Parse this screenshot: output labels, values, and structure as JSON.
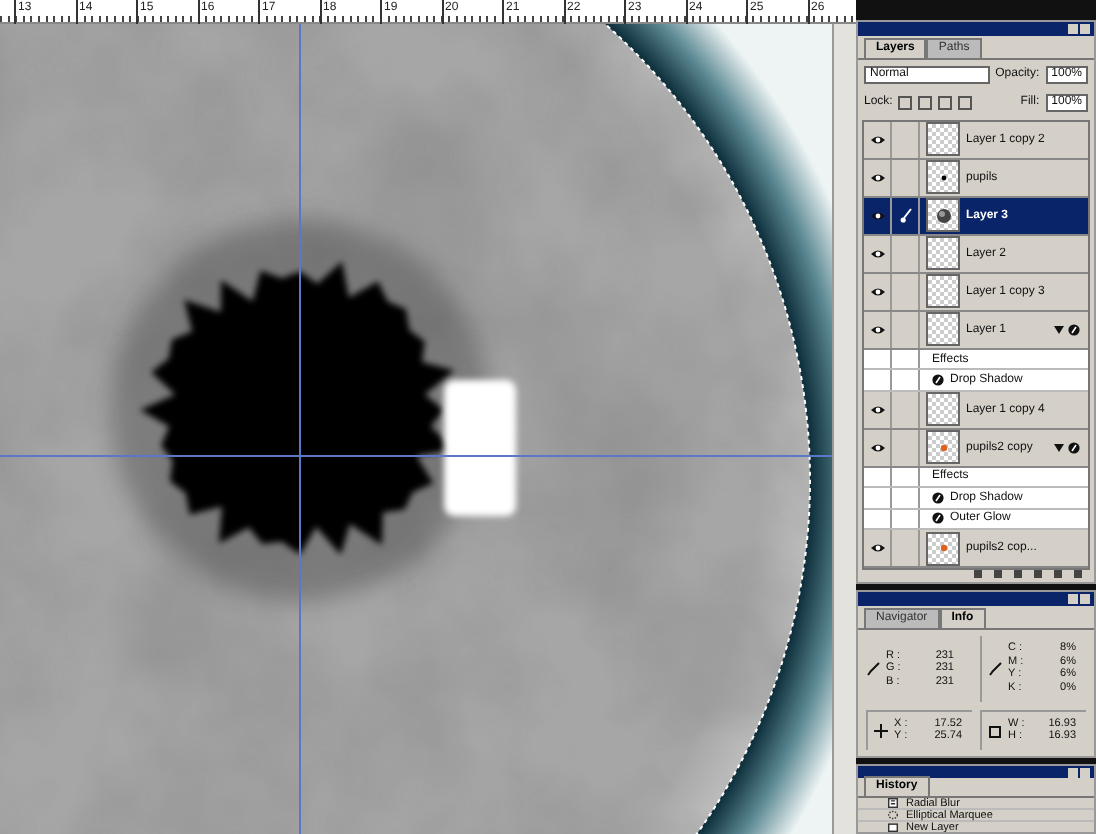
{
  "ruler": {
    "labels": [
      "13",
      "14",
      "15",
      "16",
      "17",
      "18",
      "19",
      "20",
      "21",
      "22",
      "23",
      "24",
      "25",
      "26"
    ]
  },
  "layers_palette": {
    "tabs": [
      {
        "label": "Layers",
        "selected": true
      },
      {
        "label": "Paths",
        "selected": false
      }
    ],
    "blend_mode": "Normal",
    "opacity_label": "Opacity:",
    "opacity": "100%",
    "lock_label": "Lock:",
    "fill_label": "Fill:",
    "fill": "100%",
    "layers": [
      {
        "name": "Layer 1 copy 2",
        "kind": "empty",
        "visible": true,
        "selected": false,
        "linked": false
      },
      {
        "name": "pupils",
        "kind": "dot",
        "visible": true,
        "selected": false,
        "linked": false
      },
      {
        "name": "Layer 3",
        "kind": "blob",
        "visible": true,
        "selected": true,
        "linked": true
      },
      {
        "name": "Layer 2",
        "kind": "empty",
        "visible": true,
        "selected": false,
        "linked": false
      },
      {
        "name": "Layer 1 copy 3",
        "kind": "empty",
        "visible": true,
        "selected": false,
        "linked": false
      },
      {
        "name": "Layer 1",
        "kind": "empty",
        "visible": true,
        "selected": false,
        "linked": false,
        "effects_heading": "Effects",
        "effects": [
          "Drop Shadow"
        ]
      },
      {
        "name": "Layer 1 copy 4",
        "kind": "empty",
        "visible": true,
        "selected": false,
        "linked": false
      },
      {
        "name": "pupils2 copy",
        "kind": "orange",
        "visible": true,
        "selected": false,
        "linked": false,
        "effects_heading": "Effects",
        "effects": [
          "Drop Shadow",
          "Outer Glow"
        ]
      },
      {
        "name": "pupils2 cop...",
        "kind": "orange",
        "visible": true,
        "selected": false,
        "linked": false
      }
    ]
  },
  "info_palette": {
    "tabs": [
      {
        "label": "Navigator",
        "selected": false
      },
      {
        "label": "Info",
        "selected": true
      }
    ],
    "rgb": [
      {
        "label": "R :",
        "value": "231"
      },
      {
        "label": "G :",
        "value": "231"
      },
      {
        "label": "B :",
        "value": "231"
      }
    ],
    "cmyk": [
      {
        "label": "C :",
        "value": "8%"
      },
      {
        "label": "M :",
        "value": "6%"
      },
      {
        "label": "Y :",
        "value": "6%"
      },
      {
        "label": "K :",
        "value": "0%"
      }
    ],
    "xy": [
      {
        "label": "X :",
        "value": "17.52"
      },
      {
        "label": "Y :",
        "value": "25.74"
      }
    ],
    "wh": [
      {
        "label": "W :",
        "value": "16.93"
      },
      {
        "label": "H :",
        "value": "16.93"
      }
    ]
  },
  "history_palette": {
    "tabs": [
      {
        "label": "History",
        "selected": true
      }
    ],
    "steps": [
      {
        "name": "Radial Blur",
        "kind": "filter"
      },
      {
        "name": "Elliptical Marquee",
        "kind": "marquee"
      },
      {
        "name": "New Layer",
        "kind": "layer"
      }
    ]
  }
}
